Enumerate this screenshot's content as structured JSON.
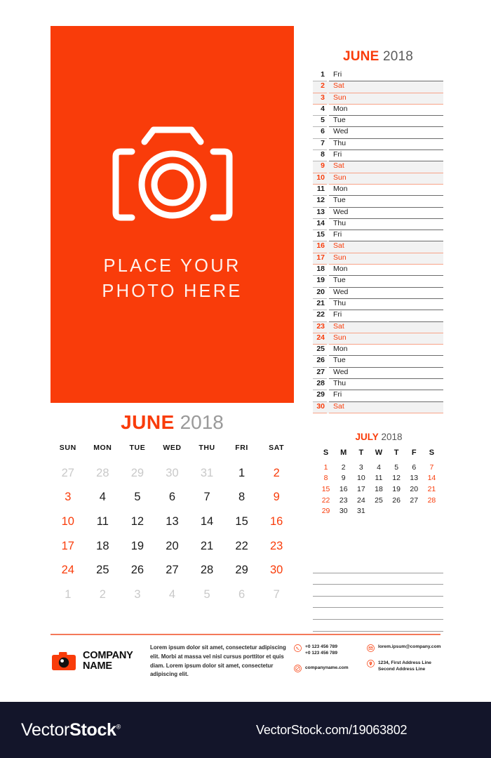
{
  "colors": {
    "accent": "#f93c0a",
    "accent_light": "#f8a388",
    "watermark_bg": "#13152a"
  },
  "photo_block": {
    "icon": "camera-icon",
    "caption_line1": "PLACE YOUR",
    "caption_line2": "PHOTO HERE"
  },
  "date_list": {
    "month": "JUNE",
    "year": "2018",
    "rows": [
      {
        "num": "1",
        "day": "Fri",
        "weekend": false
      },
      {
        "num": "2",
        "day": "Sat",
        "weekend": true
      },
      {
        "num": "3",
        "day": "Sun",
        "weekend": true
      },
      {
        "num": "4",
        "day": "Mon",
        "weekend": false
      },
      {
        "num": "5",
        "day": "Tue",
        "weekend": false
      },
      {
        "num": "6",
        "day": "Wed",
        "weekend": false
      },
      {
        "num": "7",
        "day": "Thu",
        "weekend": false
      },
      {
        "num": "8",
        "day": "Fri",
        "weekend": false
      },
      {
        "num": "9",
        "day": "Sat",
        "weekend": true
      },
      {
        "num": "10",
        "day": "Sun",
        "weekend": true
      },
      {
        "num": "11",
        "day": "Mon",
        "weekend": false
      },
      {
        "num": "12",
        "day": "Tue",
        "weekend": false
      },
      {
        "num": "13",
        "day": "Wed",
        "weekend": false
      },
      {
        "num": "14",
        "day": "Thu",
        "weekend": false
      },
      {
        "num": "15",
        "day": "Fri",
        "weekend": false
      },
      {
        "num": "16",
        "day": "Sat",
        "weekend": true
      },
      {
        "num": "17",
        "day": "Sun",
        "weekend": true
      },
      {
        "num": "18",
        "day": "Mon",
        "weekend": false
      },
      {
        "num": "19",
        "day": "Tue",
        "weekend": false
      },
      {
        "num": "20",
        "day": "Wed",
        "weekend": false
      },
      {
        "num": "21",
        "day": "Thu",
        "weekend": false
      },
      {
        "num": "22",
        "day": "Fri",
        "weekend": false
      },
      {
        "num": "23",
        "day": "Sat",
        "weekend": true
      },
      {
        "num": "24",
        "day": "Sun",
        "weekend": true
      },
      {
        "num": "25",
        "day": "Mon",
        "weekend": false
      },
      {
        "num": "26",
        "day": "Tue",
        "weekend": false
      },
      {
        "num": "27",
        "day": "Wed",
        "weekend": false
      },
      {
        "num": "28",
        "day": "Thu",
        "weekend": false
      },
      {
        "num": "29",
        "day": "Fri",
        "weekend": false
      },
      {
        "num": "30",
        "day": "Sat",
        "weekend": true
      }
    ]
  },
  "month_grid": {
    "month": "JUNE",
    "year": "2018",
    "headers": [
      "SUN",
      "MON",
      "TUE",
      "WED",
      "THU",
      "FRI",
      "SAT"
    ],
    "weeks": [
      [
        {
          "d": "27",
          "t": "out"
        },
        {
          "d": "28",
          "t": "out"
        },
        {
          "d": "29",
          "t": "out"
        },
        {
          "d": "30",
          "t": "out"
        },
        {
          "d": "31",
          "t": "out"
        },
        {
          "d": "1",
          "t": "wd"
        },
        {
          "d": "2",
          "t": "we"
        }
      ],
      [
        {
          "d": "3",
          "t": "we"
        },
        {
          "d": "4",
          "t": "wd"
        },
        {
          "d": "5",
          "t": "wd"
        },
        {
          "d": "6",
          "t": "wd"
        },
        {
          "d": "7",
          "t": "wd"
        },
        {
          "d": "8",
          "t": "wd"
        },
        {
          "d": "9",
          "t": "we"
        }
      ],
      [
        {
          "d": "10",
          "t": "we"
        },
        {
          "d": "11",
          "t": "wd"
        },
        {
          "d": "12",
          "t": "wd"
        },
        {
          "d": "13",
          "t": "wd"
        },
        {
          "d": "14",
          "t": "wd"
        },
        {
          "d": "15",
          "t": "wd"
        },
        {
          "d": "16",
          "t": "we"
        }
      ],
      [
        {
          "d": "17",
          "t": "we"
        },
        {
          "d": "18",
          "t": "wd"
        },
        {
          "d": "19",
          "t": "wd"
        },
        {
          "d": "20",
          "t": "wd"
        },
        {
          "d": "21",
          "t": "wd"
        },
        {
          "d": "22",
          "t": "wd"
        },
        {
          "d": "23",
          "t": "we"
        }
      ],
      [
        {
          "d": "24",
          "t": "we"
        },
        {
          "d": "25",
          "t": "wd"
        },
        {
          "d": "26",
          "t": "wd"
        },
        {
          "d": "27",
          "t": "wd"
        },
        {
          "d": "28",
          "t": "wd"
        },
        {
          "d": "29",
          "t": "wd"
        },
        {
          "d": "30",
          "t": "we"
        }
      ],
      [
        {
          "d": "1",
          "t": "out"
        },
        {
          "d": "2",
          "t": "out"
        },
        {
          "d": "3",
          "t": "out"
        },
        {
          "d": "4",
          "t": "out"
        },
        {
          "d": "5",
          "t": "out"
        },
        {
          "d": "6",
          "t": "out"
        },
        {
          "d": "7",
          "t": "out"
        }
      ]
    ]
  },
  "mini_grid": {
    "month": "JULY",
    "year": "2018",
    "headers": [
      "S",
      "M",
      "T",
      "W",
      "T",
      "F",
      "S"
    ],
    "weeks": [
      [
        {
          "d": "1",
          "t": "we"
        },
        {
          "d": "2",
          "t": "wd"
        },
        {
          "d": "3",
          "t": "wd"
        },
        {
          "d": "4",
          "t": "wd"
        },
        {
          "d": "5",
          "t": "wd"
        },
        {
          "d": "6",
          "t": "wd"
        },
        {
          "d": "7",
          "t": "we"
        }
      ],
      [
        {
          "d": "8",
          "t": "we"
        },
        {
          "d": "9",
          "t": "wd"
        },
        {
          "d": "10",
          "t": "wd"
        },
        {
          "d": "11",
          "t": "wd"
        },
        {
          "d": "12",
          "t": "wd"
        },
        {
          "d": "13",
          "t": "wd"
        },
        {
          "d": "14",
          "t": "we"
        }
      ],
      [
        {
          "d": "15",
          "t": "we"
        },
        {
          "d": "16",
          "t": "wd"
        },
        {
          "d": "17",
          "t": "wd"
        },
        {
          "d": "18",
          "t": "wd"
        },
        {
          "d": "19",
          "t": "wd"
        },
        {
          "d": "20",
          "t": "wd"
        },
        {
          "d": "21",
          "t": "we"
        }
      ],
      [
        {
          "d": "22",
          "t": "we"
        },
        {
          "d": "23",
          "t": "wd"
        },
        {
          "d": "24",
          "t": "wd"
        },
        {
          "d": "25",
          "t": "wd"
        },
        {
          "d": "26",
          "t": "wd"
        },
        {
          "d": "27",
          "t": "wd"
        },
        {
          "d": "28",
          "t": "we"
        }
      ],
      [
        {
          "d": "29",
          "t": "we"
        },
        {
          "d": "30",
          "t": "wd"
        },
        {
          "d": "31",
          "t": "wd"
        },
        {
          "d": "",
          "t": "wd"
        },
        {
          "d": "",
          "t": "wd"
        },
        {
          "d": "",
          "t": "wd"
        },
        {
          "d": "",
          "t": "wd"
        }
      ]
    ]
  },
  "notes": {
    "line_count": 6
  },
  "footer": {
    "logo_icon": "camera-icon",
    "company_line1": "COMPANY",
    "company_line2": "NAME",
    "blurb": "Lorem ipsum dolor sit amet, consectetur adipiscing elit. Morbi at massa vel nisl cursus porttitor et quis diam. Lorem ipsum dolor sit amet, consectetur adipiscing elit.",
    "contacts": {
      "phone_icon": "phone-icon",
      "phone1": "+0 123 456 789",
      "phone2": "+0 123 456 789",
      "web_icon": "globe-icon",
      "website": "companyname.com",
      "email_icon": "envelope-icon",
      "email": "lorem.ipsum@company.com",
      "address_icon": "location-pin-icon",
      "address1": "1234, First Address Line",
      "address2": "Second Address Line"
    }
  },
  "watermark": {
    "brand_light": "Vector",
    "brand_bold": "Stock",
    "registered": "®",
    "url": "VectorStock.com/19063802"
  }
}
